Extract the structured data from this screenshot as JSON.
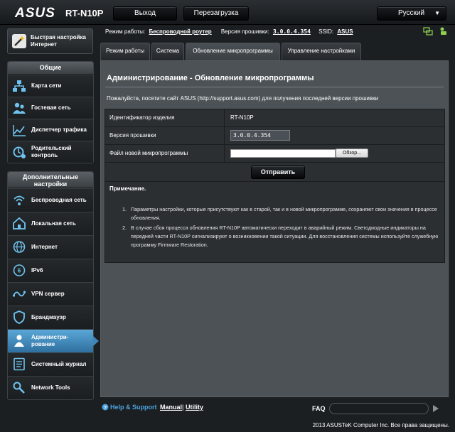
{
  "header": {
    "logo": "ASUS",
    "model": "RT-N10P",
    "logout_label": "Выход",
    "reboot_label": "Перезагрузка",
    "language": "Русский"
  },
  "status": {
    "mode_label": "Режим работы:",
    "mode_value": "Беспроводной роутер",
    "fw_label": "Версия прошивки:",
    "fw_value": "3.0.0.4.354",
    "ssid_label": "SSID:",
    "ssid_value": "ASUS"
  },
  "sidebar": {
    "quick_setup": "Быстрая настройка Интернет",
    "general_title": "Общие",
    "general_items": [
      {
        "label": "Карта сети",
        "icon": "network-map-icon"
      },
      {
        "label": "Гостевая сеть",
        "icon": "guest-network-icon"
      },
      {
        "label": "Диспетчер трафика",
        "icon": "traffic-manager-icon"
      },
      {
        "label": "Родительский контроль",
        "icon": "parental-control-icon"
      }
    ],
    "advanced_title": "Дополнительные настройки",
    "advanced_items": [
      {
        "label": "Беспроводная сеть",
        "icon": "wireless-icon"
      },
      {
        "label": "Локальная сеть",
        "icon": "lan-icon"
      },
      {
        "label": "Интернет",
        "icon": "internet-icon"
      },
      {
        "label": "IPv6",
        "icon": "ipv6-icon"
      },
      {
        "label": "VPN сервер",
        "icon": "vpn-icon"
      },
      {
        "label": "Брандмауэр",
        "icon": "firewall-icon"
      },
      {
        "label": "Администри-рование",
        "icon": "administration-icon"
      },
      {
        "label": "Системный журнал",
        "icon": "system-log-icon"
      },
      {
        "label": "Network Tools",
        "icon": "network-tools-icon"
      }
    ],
    "active_item": "Администри-рование"
  },
  "tabs": [
    {
      "label": "Режим работы"
    },
    {
      "label": "Система"
    },
    {
      "label": "Обновление микропрограммы"
    },
    {
      "label": "Управление настройками"
    }
  ],
  "main": {
    "title": "Администрирование - Обновление микропрограммы",
    "description": "Пожалуйста, посетите сайт ASUS (http://support.asus.com) для получения последней версии прошивки",
    "rows": {
      "model_label": "Идентификатор изделия",
      "model_value": "RT-N10P",
      "fw_label": "Версия прошивки",
      "fw_value": "3.0.0.4.354",
      "file_label": "Файл новой микропрограммы",
      "browse_label": "Обзор..."
    },
    "submit_label": "Отправить",
    "notes_title": "Примечание.",
    "notes": [
      "Параметры настройки, которые присутствуют как в старой, так и в новой микропрограмме, сохраняют свои значения в процессе обновления.",
      "В случае сбоя процесса обновления RT-N10P автоматически переходит в аварийный режим. Светодиодные индикаторы на передней части RT-N10P сигнализируют о возникновении такой ситуации. Для восстановления системы используйте служебную программу Firmware Restoration."
    ]
  },
  "footer": {
    "help_label": "Help & Support",
    "manual_label": "Manual",
    "separator": "|",
    "utility_label": "Utility",
    "faq_label": "FAQ",
    "copyright": "2013  ASUSTeK Computer Inc. Все права защищены."
  },
  "colors": {
    "accent": "#4aa3df",
    "active_nav": "#3e86b8",
    "panel_bg": "#4c5256"
  }
}
